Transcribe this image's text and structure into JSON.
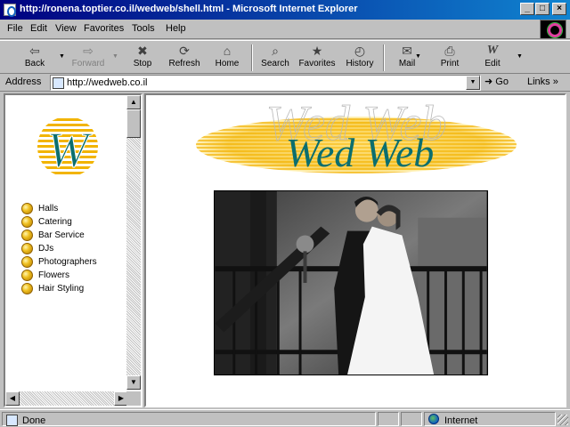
{
  "window": {
    "title": "http://ronena.toptier.co.il/wedweb/shell.html - Microsoft Internet Explorer",
    "min_label": "_",
    "max_label": "□",
    "close_label": "×"
  },
  "menu": {
    "items": [
      "File",
      "Edit",
      "View",
      "Favorites",
      "Tools",
      "Help"
    ]
  },
  "toolbar": {
    "back": {
      "label": "Back",
      "icon": "back-arrow-icon",
      "glyph": "⇦"
    },
    "forward": {
      "label": "Forward",
      "icon": "forward-arrow-icon",
      "glyph": "⇨"
    },
    "stop": {
      "label": "Stop",
      "icon": "stop-icon",
      "glyph": "✖"
    },
    "refresh": {
      "label": "Refresh",
      "icon": "refresh-icon",
      "glyph": "⟳"
    },
    "home": {
      "label": "Home",
      "icon": "home-icon",
      "glyph": "⌂"
    },
    "search": {
      "label": "Search",
      "icon": "search-icon",
      "glyph": "⌕"
    },
    "favorites": {
      "label": "Favorites",
      "icon": "favorites-icon",
      "glyph": "★"
    },
    "history": {
      "label": "History",
      "icon": "history-icon",
      "glyph": "◴"
    },
    "mail": {
      "label": "Mail",
      "icon": "mail-icon",
      "glyph": "✉"
    },
    "print": {
      "label": "Print",
      "icon": "print-icon",
      "glyph": "⎙"
    },
    "edit": {
      "label": "Edit",
      "icon": "edit-icon",
      "glyph": "W"
    }
  },
  "address": {
    "label": "Address",
    "value": "http://wedweb.co.il",
    "go_label": "Go",
    "links_label": "Links »"
  },
  "site": {
    "logo_letter": "W",
    "banner_text": "Wed Web",
    "nav": [
      {
        "label": "Halls"
      },
      {
        "label": "Catering"
      },
      {
        "label": "Bar Service"
      },
      {
        "label": "DJs"
      },
      {
        "label": "Photographers"
      },
      {
        "label": "Flowers"
      },
      {
        "label": "Hair Styling"
      }
    ]
  },
  "status": {
    "text": "Done",
    "zone": "Internet"
  },
  "colors": {
    "titlebar_start": "#000080",
    "titlebar_end": "#1084d0",
    "logo_teal": "#0b6e6e",
    "logo_gold": "#f2b400"
  }
}
